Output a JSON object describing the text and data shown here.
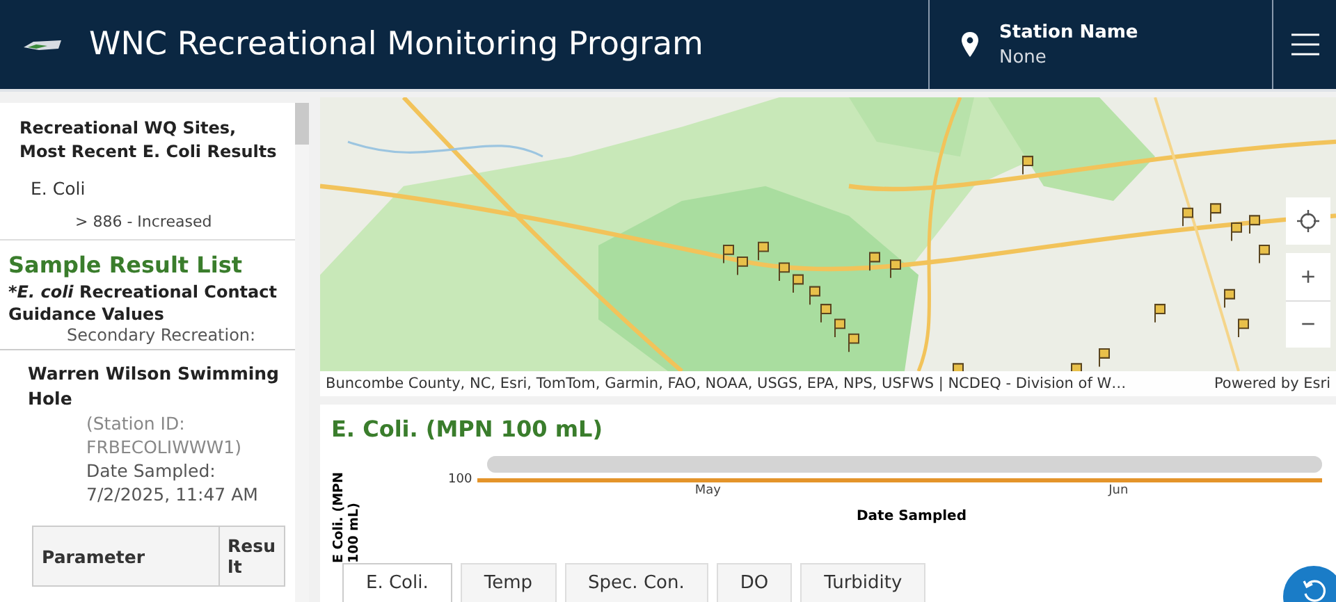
{
  "header": {
    "title": "WNC Recreational Monitoring Program",
    "station_label": "Station Name",
    "station_value": "None"
  },
  "legend_panel": {
    "title": "Recreational WQ Sites, Most Recent E. Coli Results",
    "layer": "E. Coli",
    "class_label": "> 886 - Increased"
  },
  "result_list": {
    "title": "Sample Result List",
    "guidance": {
      "prefix": "*",
      "species": "E. coli",
      "rest": " Recreational Contact Guidance Values"
    },
    "subheading": "Secondary Recreation:"
  },
  "site": {
    "name": "Warren Wilson Swimming Hole",
    "station_id": "(Station ID: FRBECOLIWWW1)",
    "date_label": "Date Sampled:",
    "date": "7/2/2025, 11:47 AM",
    "columns": [
      "Parameter",
      "Resu lt"
    ]
  },
  "map": {
    "attribution": "Buncombe County, NC, Esri, TomTom, Garmin, FAO, NOAA, USGS, EPA, NPS, USFWS | NCDEQ - Division of W…",
    "powered_by": "Powered by Esri",
    "controls": [
      {
        "kind": "locate"
      },
      {
        "kind": "zoom-in",
        "label": "+"
      },
      {
        "kind": "zoom-out",
        "label": "−"
      }
    ]
  },
  "chart_panel": {
    "title": "E. Coli. (MPN 100 mL)",
    "range_slider": {
      "level": 1
    },
    "ylabel": "E Coli. (MPN 100 mL)",
    "ytick": "100",
    "xticks": [
      "May",
      "Jun"
    ],
    "xlabel": "Date Sampled"
  },
  "tabs": [
    {
      "label": "E. Coli.",
      "selected": true
    },
    {
      "label": "Temp",
      "selected": false
    },
    {
      "label": "Spec. Con.",
      "selected": false
    },
    {
      "label": "DO",
      "selected": false
    },
    {
      "label": "Turbidity",
      "selected": false
    }
  ]
}
